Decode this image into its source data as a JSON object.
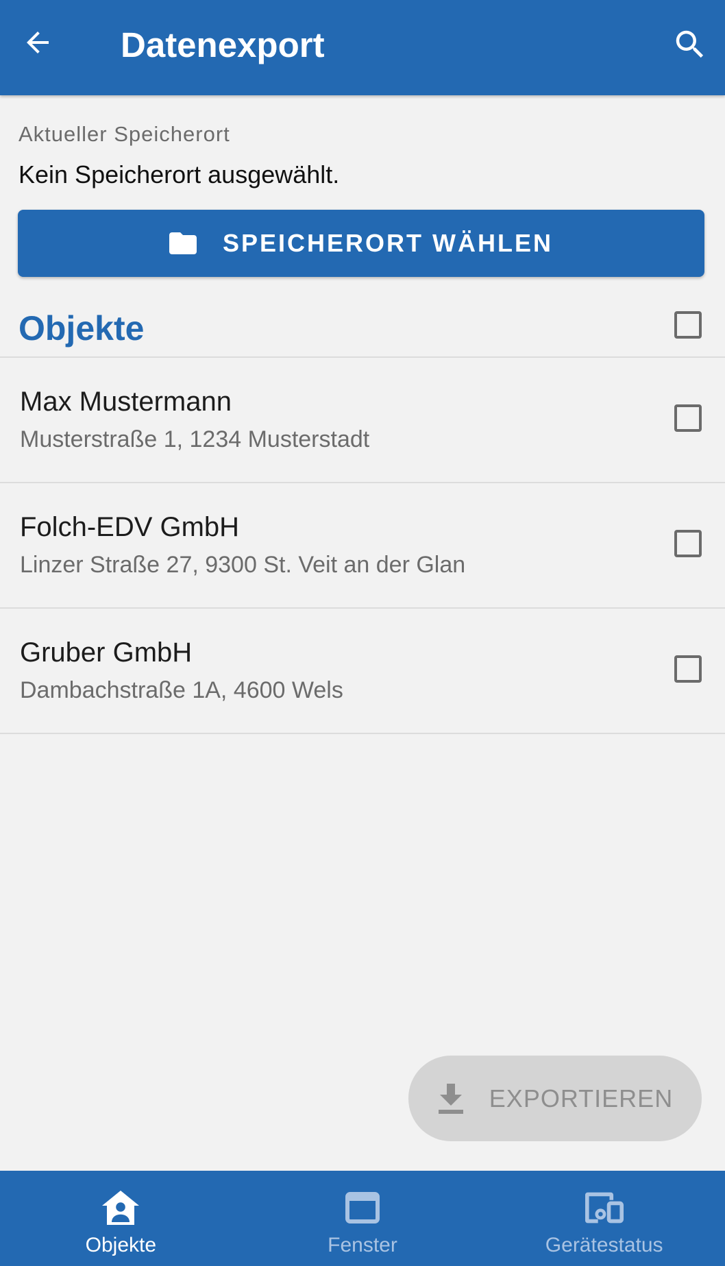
{
  "appbar": {
    "title": "Datenexport",
    "back_icon": "arrow-back-icon",
    "search_icon": "search-icon"
  },
  "storage": {
    "label": "Aktueller Speicherort",
    "value": "Kein Speicherort ausgewählt.",
    "button_label": "SPEICHERORT WÄHLEN",
    "button_icon": "folder-icon"
  },
  "section": {
    "title": "Objekte",
    "select_all_checked": false
  },
  "objects": [
    {
      "name": "Max Mustermann",
      "address": "Musterstraße 1, 1234 Musterstadt",
      "checked": false
    },
    {
      "name": "Folch-EDV GmbH",
      "address": "Linzer Straße 27, 9300 St. Veit an der Glan",
      "checked": false
    },
    {
      "name": "Gruber GmbH",
      "address": "Dambachstraße 1A, 4600 Wels",
      "checked": false
    }
  ],
  "export": {
    "label": "EXPORTIEREN",
    "icon": "download-icon",
    "enabled": false
  },
  "bottom_nav": {
    "items": [
      {
        "label": "Objekte",
        "icon": "home-person-icon",
        "active": true
      },
      {
        "label": "Fenster",
        "icon": "window-icon",
        "active": false
      },
      {
        "label": "Gerätestatus",
        "icon": "devices-icon",
        "active": false
      }
    ]
  },
  "colors": {
    "primary": "#2369b2",
    "background": "#f2f2f2",
    "nav_inactive": "#a9c3e3",
    "disabled_button": "#d4d4d4"
  }
}
